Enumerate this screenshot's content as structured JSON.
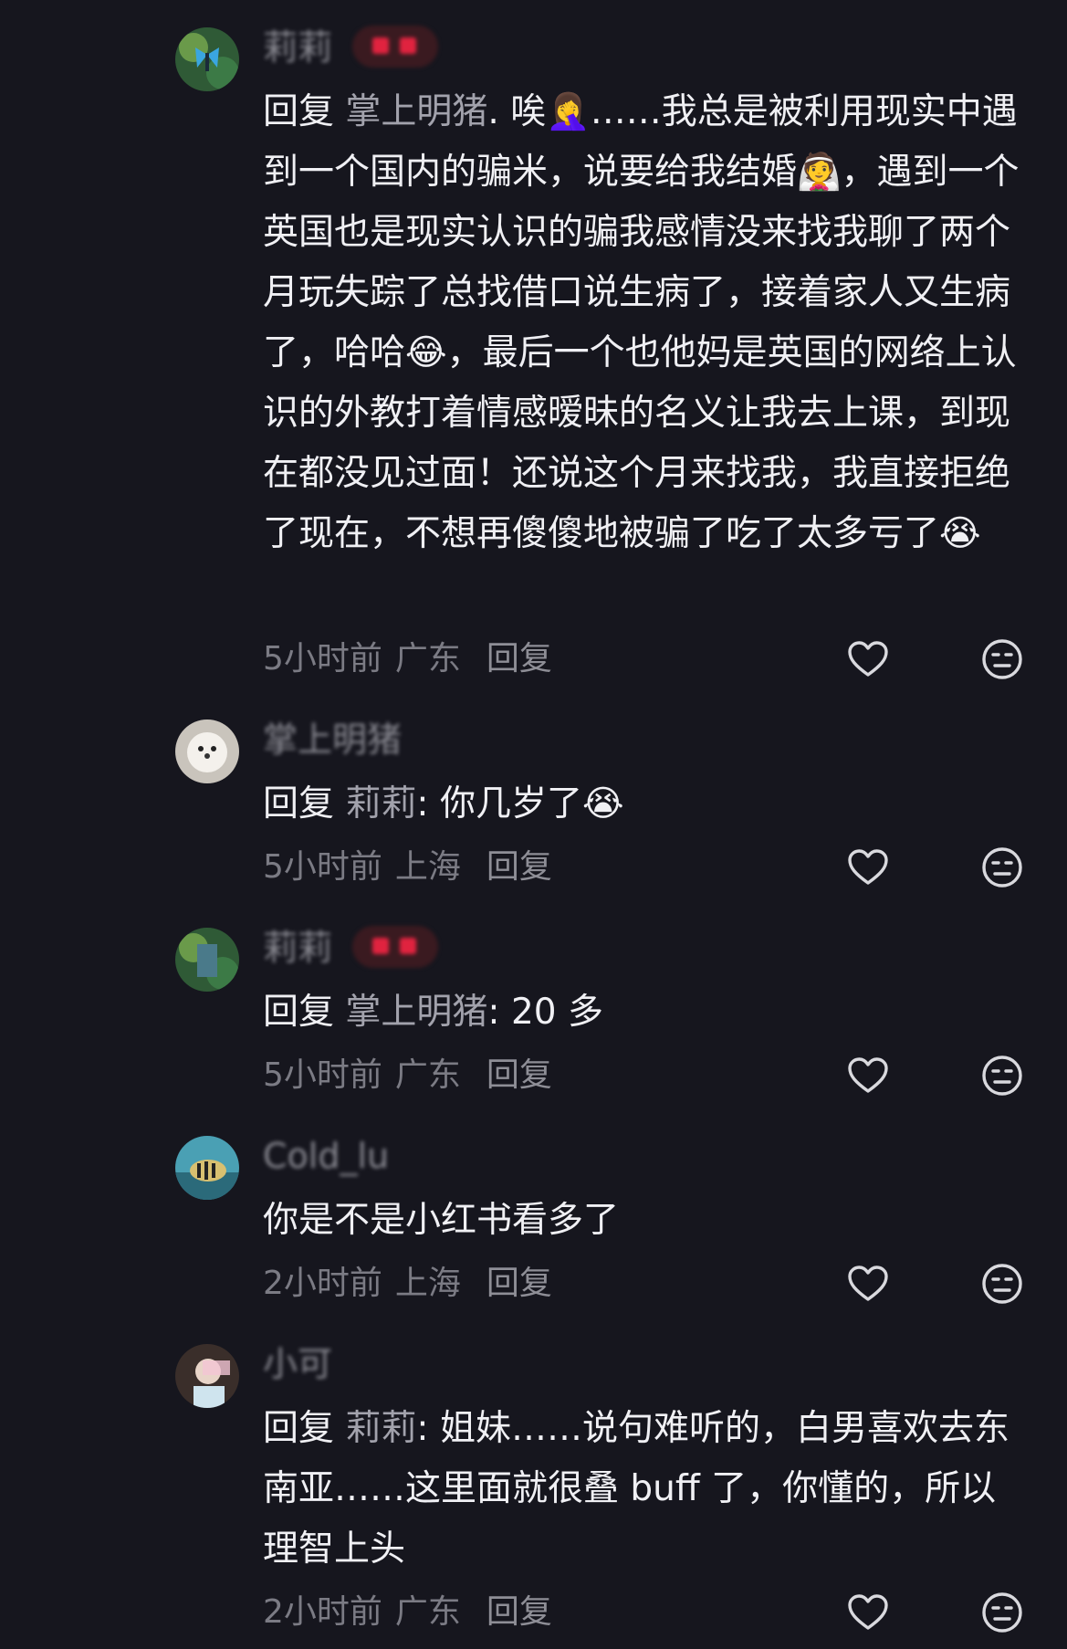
{
  "comments": [
    {
      "username": "莉莉",
      "reply_prefix": "回复 ",
      "reply_to": "掌上明猪",
      "text": ". 唉🤦‍♀️……我总是被利用现实中遇到一个国内的骗米，说要给我结婚👰，遇到一个英国也是现实认识的骗我感情没来找我聊了两个月玩失踪了总找借口说生病了，接着家人又生病了，哈哈😂，最后一个也他妈是英国的网络上认识的外教打着情感暧昧的名义让我去上课，到现在都没见过面！还说这个月来找我，我直接拒绝了现在，不想再傻傻地被骗了吃了太多亏了😭",
      "time": "5小时前",
      "location": "广东",
      "reply_label": "回复"
    },
    {
      "username": "掌上明猪",
      "reply_prefix": "回复 ",
      "reply_to": "莉莉",
      "text": ": 你几岁了😭",
      "time": "5小时前",
      "location": "上海",
      "reply_label": "回复"
    },
    {
      "username": "莉莉",
      "reply_prefix": "回复 ",
      "reply_to": "掌上明猪",
      "text": ": 20 多",
      "time": "5小时前",
      "location": "广东",
      "reply_label": "回复"
    },
    {
      "username": "Cold_lu",
      "reply_prefix": "",
      "reply_to": "",
      "text": "你是不是小红书看多了",
      "time": "2小时前",
      "location": "上海",
      "reply_label": "回复"
    },
    {
      "username": "小可",
      "reply_prefix": "回复 ",
      "reply_to": "莉莉",
      "text": ": 姐妹……说句难听的，白男喜欢去东南亚……这里面就很叠 buff 了，你懂的，所以理智上头",
      "time": "2小时前",
      "location": "广东",
      "reply_label": "回复"
    }
  ],
  "icons": {
    "like": "heart-outline-icon",
    "dislike": "meh-face-icon"
  },
  "colors": {
    "background": "#16161e",
    "badge": "#e0233f"
  }
}
